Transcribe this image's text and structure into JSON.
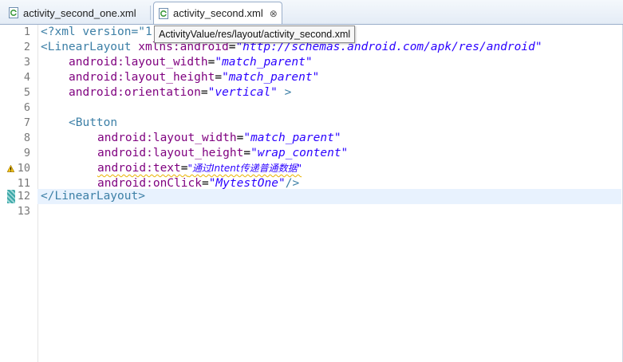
{
  "tabs": [
    {
      "label": "activity_second_one.xml",
      "active": false
    },
    {
      "label": "activity_second.xml",
      "active": true,
      "close_glyph": "⊗"
    }
  ],
  "tooltip": "ActivityValue/res/layout/activity_second.xml",
  "lines": [
    {
      "num": "1",
      "parts": [
        "<?xml version=\"1"
      ]
    },
    {
      "num": "2",
      "parts": [
        "<LinearLayout",
        " xmlns:android",
        "=",
        "\"http://schemas.android.com/apk/res/android\""
      ]
    },
    {
      "num": "3",
      "parts": [
        "android:layout_width",
        "=",
        "\"match_parent\""
      ]
    },
    {
      "num": "4",
      "parts": [
        "android:layout_height",
        "=",
        "\"match_parent\""
      ]
    },
    {
      "num": "5",
      "parts": [
        "android:orientation",
        "=",
        "\"vertical\"",
        " >"
      ]
    },
    {
      "num": "6",
      "parts": []
    },
    {
      "num": "7",
      "parts": [
        "<Button"
      ]
    },
    {
      "num": "8",
      "parts": [
        "android:layout_width",
        "=",
        "\"match_parent\""
      ]
    },
    {
      "num": "9",
      "parts": [
        "android:layout_height",
        "=",
        "\"wrap_content\""
      ]
    },
    {
      "num": "10",
      "parts": [
        "android:text",
        "=",
        "\"通过Intent传递普通数据\""
      ]
    },
    {
      "num": "11",
      "parts": [
        "android:onClick",
        "=",
        "\"MytestOne\"",
        "/>"
      ]
    },
    {
      "num": "12",
      "parts": [
        "</LinearLayout>"
      ]
    },
    {
      "num": "13",
      "parts": []
    }
  ],
  "colors": {
    "tag": "#3c7fa6",
    "attribute": "#7f007f",
    "value": "#2a00ff",
    "current_line": "#e8f2fe",
    "warning": "#e8b200"
  },
  "icons": {
    "tab_file": "xml-file-icon",
    "warning": "warning-icon",
    "quick_fix": "change-marker-icon"
  }
}
